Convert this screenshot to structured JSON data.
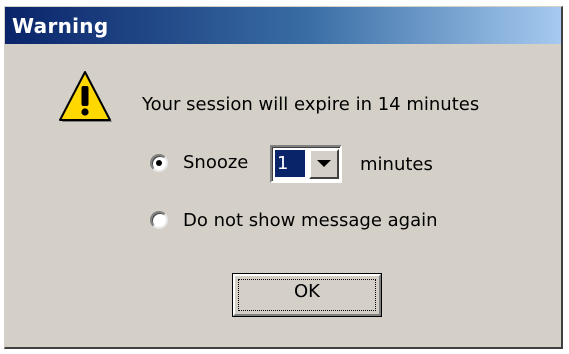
{
  "dialog": {
    "title": "Warning",
    "message": "Your session will expire in 14 minutes",
    "icon": "warning-icon"
  },
  "options": {
    "snooze_label": "Snooze",
    "snooze_selected": true,
    "snooze_value": "1",
    "units_label": "minutes",
    "dont_show_label": "Do not show message again",
    "dont_show_selected": false
  },
  "buttons": {
    "ok_label": "OK"
  },
  "colors": {
    "titlebar_start": "#0a246a",
    "titlebar_end": "#a6caf0",
    "dialog_bg": "#d4d0c8",
    "icon_fill": "#ffd800"
  }
}
